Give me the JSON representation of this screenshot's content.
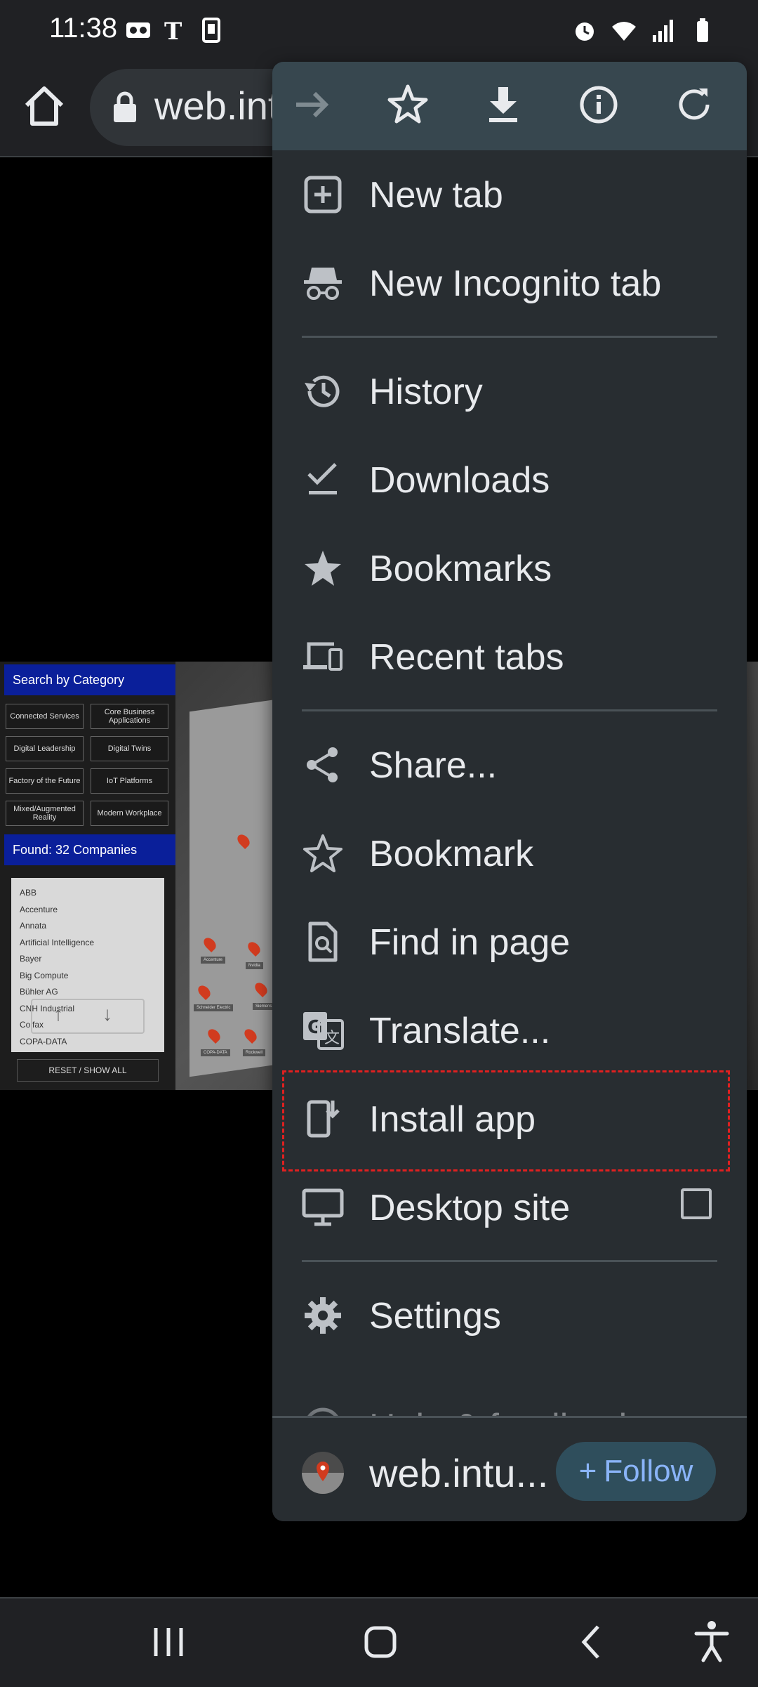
{
  "status_bar": {
    "time": "11:38",
    "left_icons": [
      "voicemail-icon",
      "nyt-icon",
      "cast-phone-icon"
    ],
    "right_icons": [
      "alarm-icon",
      "wifi-icon",
      "signal-icon",
      "battery-icon"
    ]
  },
  "toolbar": {
    "url": "web.int"
  },
  "page": {
    "search_header": "Search by Category",
    "categories": [
      "Connected Services",
      "Core Business Applications",
      "Digital Leadership",
      "Digital Twins",
      "Factory of the Future",
      "IoT Platforms",
      "Mixed/Augmented Reality",
      "Modern Workplace"
    ],
    "found_header": "Found: 32 Companies",
    "companies": [
      "ABB",
      "Accenture",
      "Annata",
      "Artificial Intelligence",
      "Bayer",
      "Big Compute",
      "Bühler AG",
      "CNH Industrial",
      "Colfax",
      "COPA-DATA"
    ],
    "reset_label": "RESET / SHOW ALL",
    "booth_labels": [
      "Accenture",
      "Nvidia",
      "Schneider Electric",
      "Siemens",
      "COPA-DATA",
      "Rockwell"
    ]
  },
  "menu": {
    "top_icons": [
      "forward-arrow-icon",
      "star-outline-icon",
      "download-icon",
      "info-icon",
      "refresh-icon"
    ],
    "items": {
      "new_tab": "New tab",
      "new_incognito_tab": "New Incognito tab",
      "history": "History",
      "downloads": "Downloads",
      "bookmarks": "Bookmarks",
      "recent_tabs": "Recent tabs",
      "share": "Share...",
      "bookmark": "Bookmark",
      "find_in_page": "Find in page",
      "translate": "Translate...",
      "install_app": "Install app",
      "desktop_site": "Desktop site",
      "settings": "Settings",
      "help_feedback": "Help & feedback"
    },
    "desktop_site_checked": false,
    "footer": {
      "site_name": "web.intu...",
      "follow_label": "Follow",
      "follow_prefix": "+"
    },
    "colors": {
      "menu_bg": "#282d31",
      "top_bar_bg": "#37474f",
      "follow_text": "#8ab4f8",
      "highlight_border": "#e02020"
    }
  },
  "nav_bar": {
    "buttons": [
      "recent-apps-icon",
      "home-icon",
      "back-icon",
      "accessibility-icon"
    ]
  }
}
